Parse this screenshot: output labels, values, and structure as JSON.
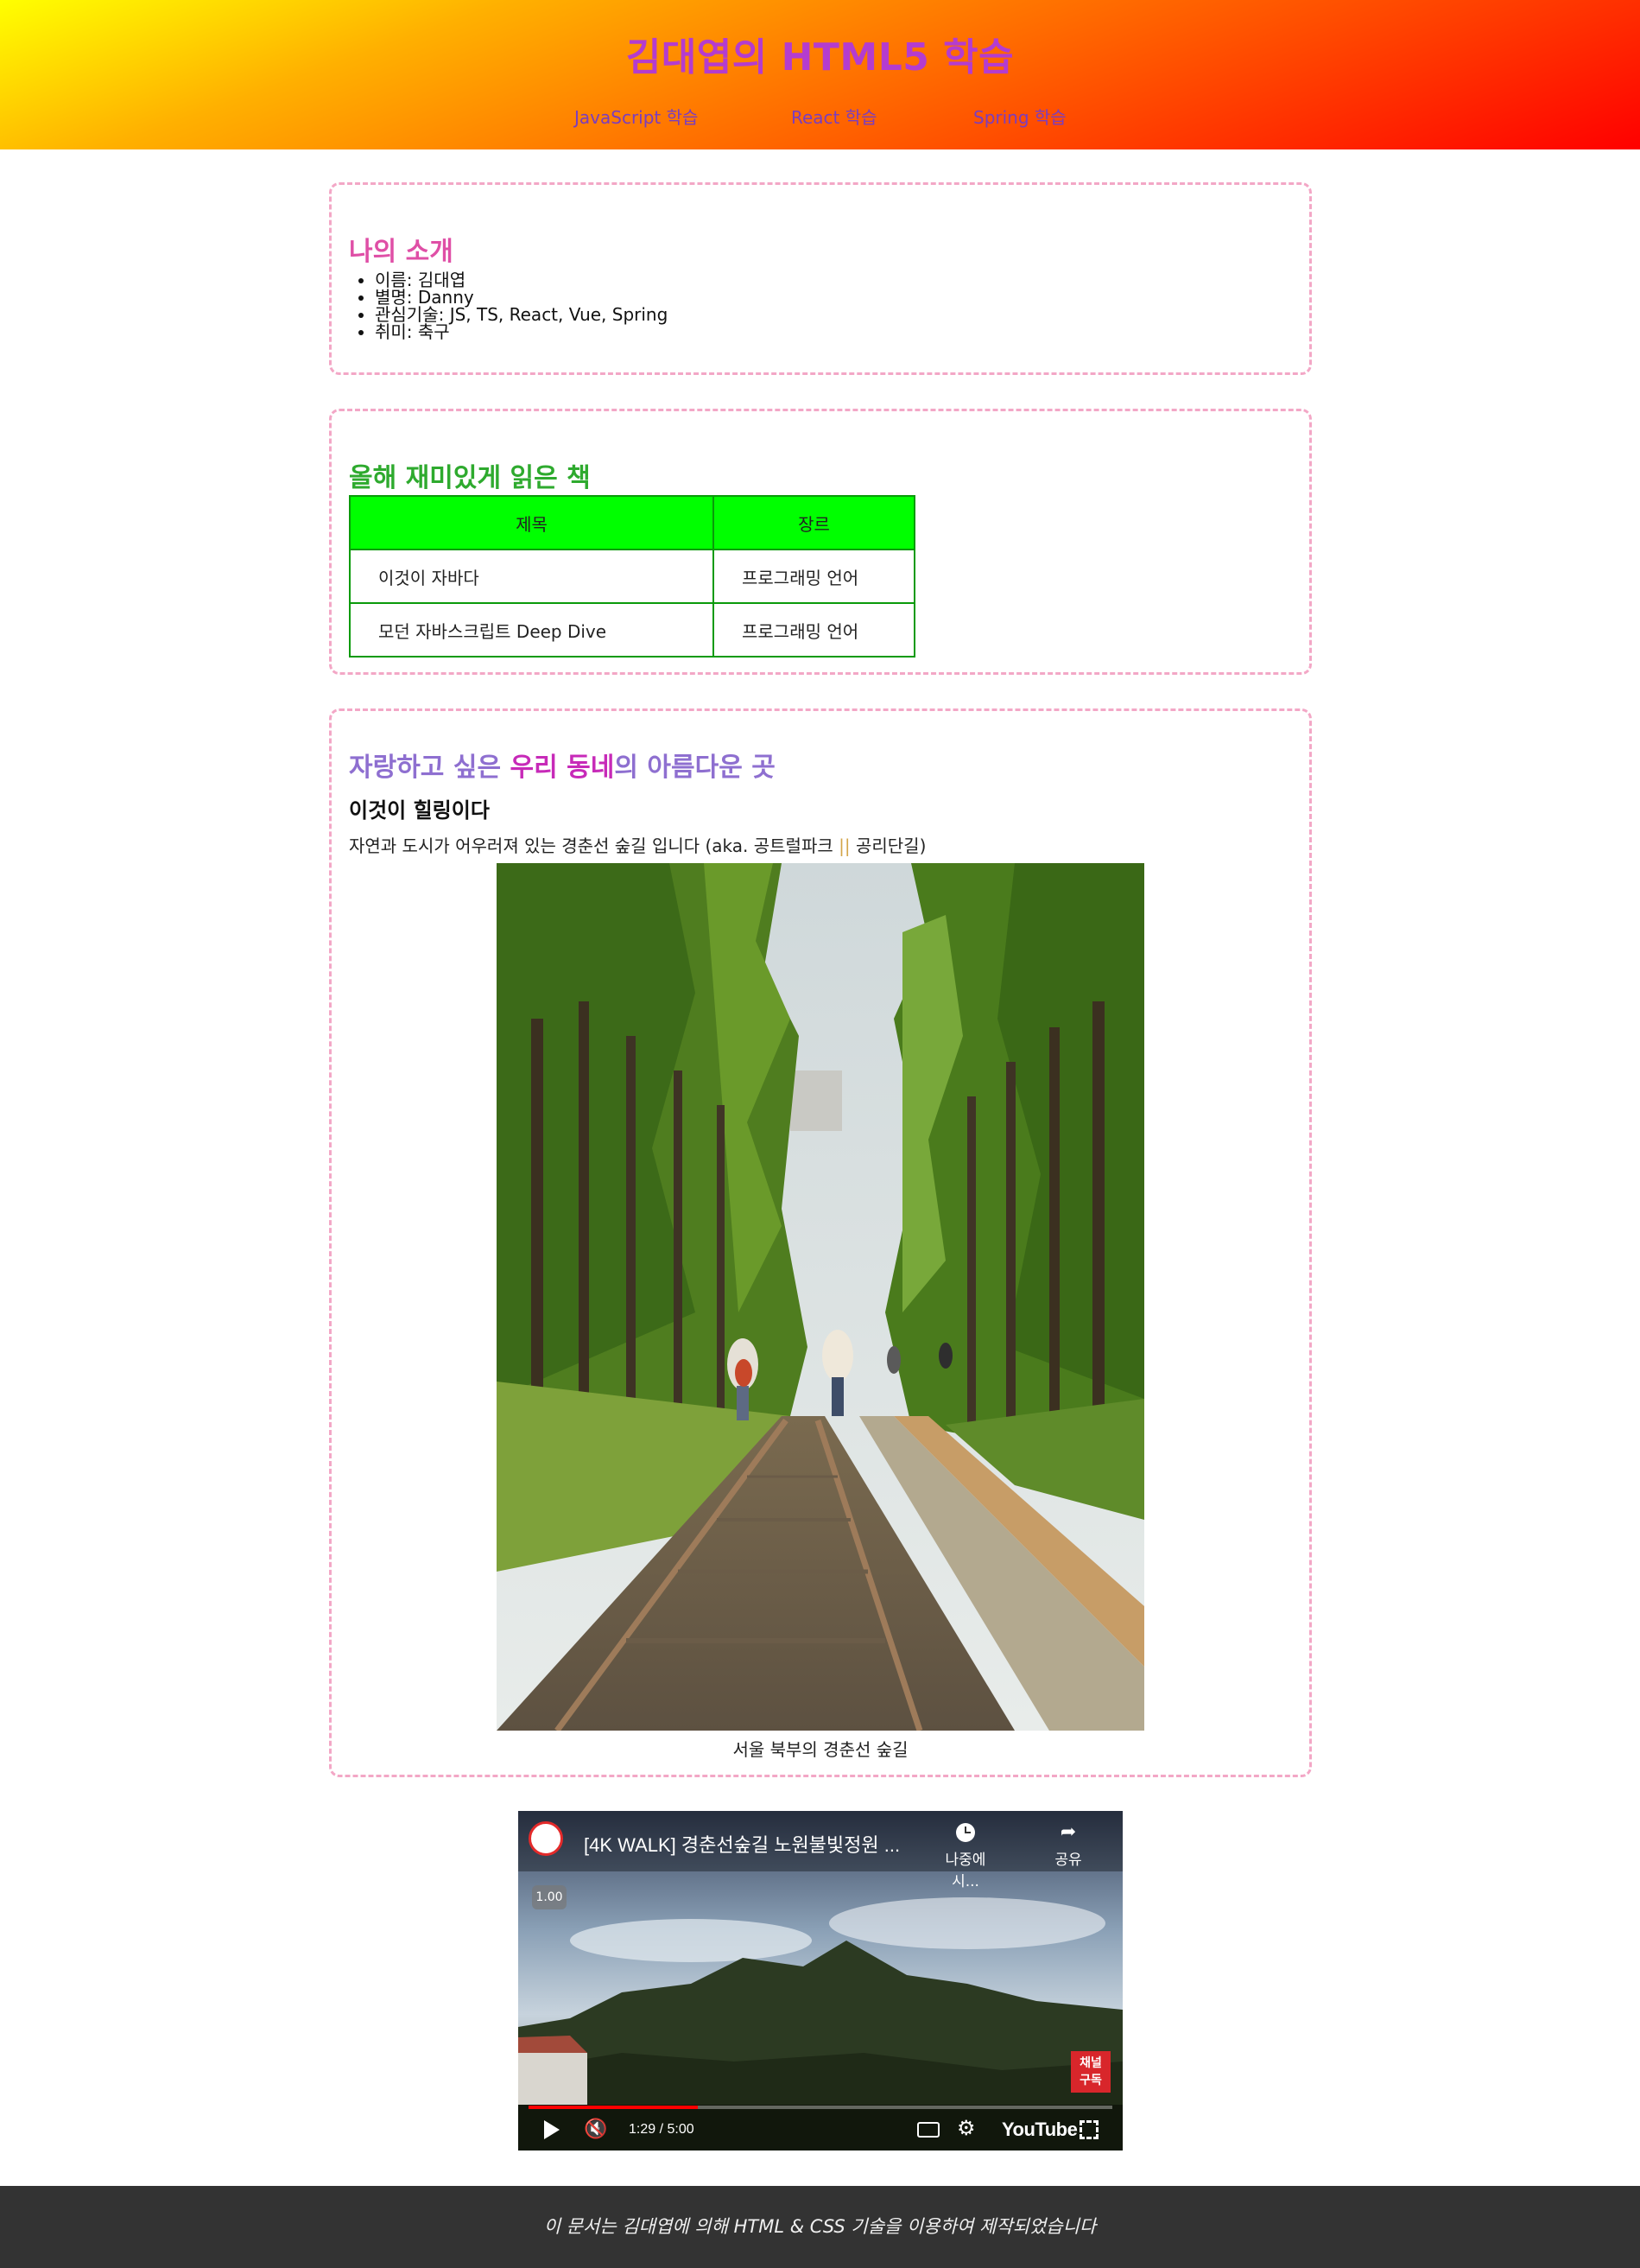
{
  "header": {
    "title": "김대엽의 HTML5 학습",
    "nav": [
      {
        "label": "JavaScript 학습"
      },
      {
        "label": "React 학습"
      },
      {
        "label": "Spring 학습"
      }
    ]
  },
  "intro": {
    "title": "나의 소개",
    "items": [
      "이름: 김대엽",
      "별명: Danny",
      "관심기술: JS, TS, React, Vue, Spring",
      "취미: 축구"
    ]
  },
  "books": {
    "title": "올해 재미있게 읽은 책",
    "columns": [
      "제목",
      "장르"
    ],
    "rows": [
      [
        "이것이 자바다",
        "프로그래밍 언어"
      ],
      [
        "모던 자바스크립트 Deep Dive",
        "프로그래밍 언어"
      ]
    ]
  },
  "place": {
    "title_part1": "자랑하고 싶은 ",
    "title_highlight": "우리 동네",
    "title_part2": "의 아름다운 곳",
    "subtitle": "이것이 힐링이다",
    "desc_part1": "자연과 도시가 어우러져 있는 경춘선 숲길 입니다 (aka. 공트럴파크 ",
    "desc_sep": "||",
    "desc_part2": " 공리단길)",
    "caption": "서울 북부의 경춘선 숲길"
  },
  "video": {
    "title": "[4K WALK] 경춘선숲길 노원불빛정원 ...",
    "watch_later": "나중에 시...",
    "share": "공유",
    "speed": "1.00",
    "time": "1:29 / 5:00",
    "brand": "YouTube",
    "badge_line1": "채널",
    "badge_line2": "구독",
    "progress": 0.29
  },
  "footer": {
    "text": "이 문서는 김대엽에 의해 HTML & CSS 기술을 이용하여 제작되었습니다"
  }
}
